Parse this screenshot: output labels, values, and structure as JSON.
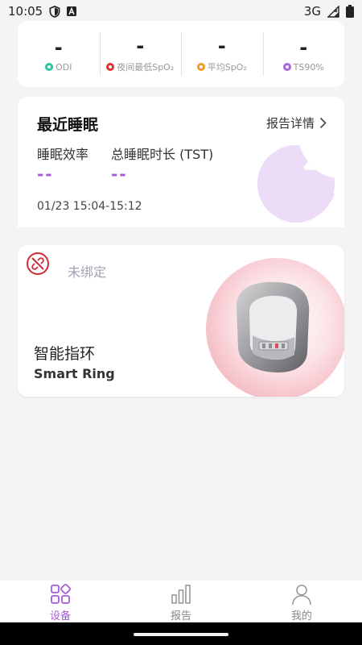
{
  "status_bar": {
    "time": "10:05",
    "network": "3G",
    "icons": [
      "shield-icon",
      "a-badge-icon",
      "signal-icon",
      "battery-icon"
    ]
  },
  "metrics": [
    {
      "value": "-",
      "label": "ODI",
      "color": "#27c59a"
    },
    {
      "value": "-",
      "label": "夜间最低SpO₂",
      "color": "#e0312f"
    },
    {
      "value": "-",
      "label": "平均SpO₂",
      "color": "#f39a2c"
    },
    {
      "value": "-",
      "label": "TS90%",
      "color": "#a765e0"
    }
  ],
  "sleep": {
    "title": "最近睡眠",
    "report_link": "报告详情",
    "efficiency_label": "睡眠效率",
    "efficiency_value": "--",
    "tst_label": "总睡眠时长 (TST)",
    "tst_value": "--",
    "time_range": "01/23 15:04-15:12",
    "moon_icon": "moon-z-icon"
  },
  "device": {
    "status": "未绑定",
    "name": "智能指环",
    "name_en": "Smart Ring",
    "status_icon": "unlink-icon"
  },
  "tabs": [
    {
      "label": "设备",
      "icon": "device-grid-icon",
      "active": true
    },
    {
      "label": "报告",
      "icon": "bar-chart-icon",
      "active": false
    },
    {
      "label": "我的",
      "icon": "person-icon",
      "active": false
    }
  ],
  "colors": {
    "accent": "#a55bdc",
    "background": "#f4f4f5",
    "moon": "#ecdcf8"
  }
}
